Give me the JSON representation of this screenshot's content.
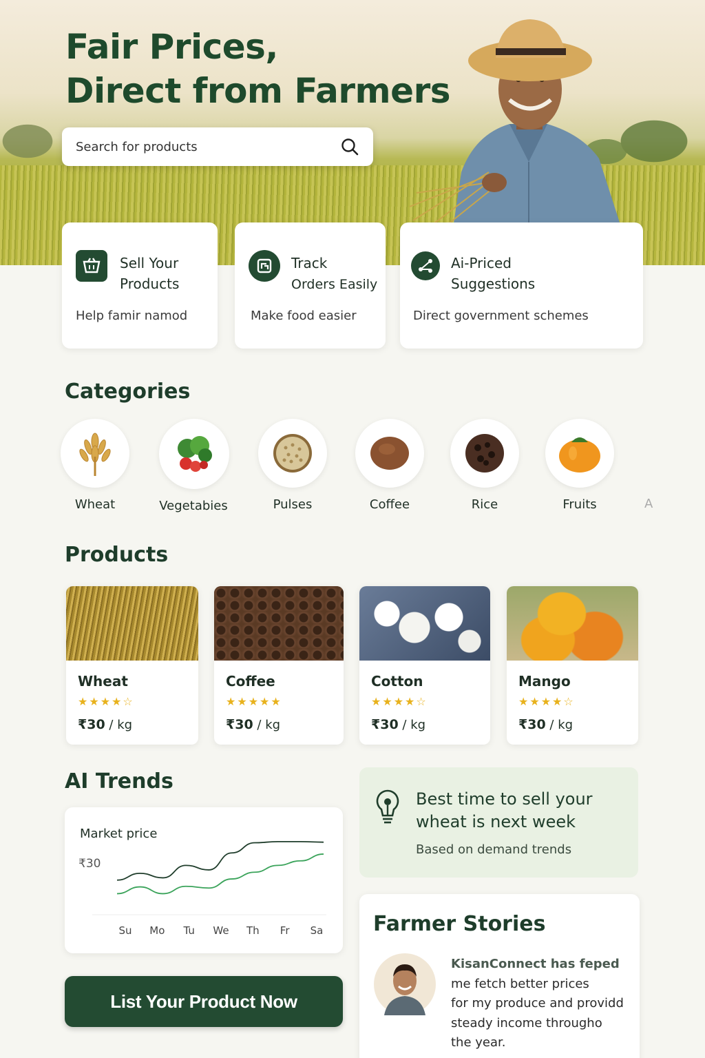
{
  "hero": {
    "title_line1": "Fair Prices,",
    "title_line2": "Direct from Farmers",
    "search_placeholder": "Search for products"
  },
  "features": [
    {
      "title_line1": "Sell Your",
      "title_line2": "Products",
      "desc": "Help famir namod",
      "icon": "basket-icon"
    },
    {
      "title_line1": "Track",
      "title_line2": "Orders Easily",
      "desc": "Make food easier",
      "icon": "tracking-icon"
    },
    {
      "title_line1": "Ai-Priced",
      "title_line2": "Suggestions",
      "desc": "Direct government schemes",
      "icon": "ai-network-icon"
    }
  ],
  "categories_title": "Categories",
  "categories": [
    "Wheat",
    "Vegetabies",
    "Pulses",
    "Coffee",
    "Rice",
    "Fruits"
  ],
  "categories_more": "A",
  "products_title": "Products",
  "products": [
    {
      "name": "Wheat",
      "stars": "★★★★☆",
      "rating": 4.5,
      "currency": "₹",
      "price": "30",
      "unit": "/ kg"
    },
    {
      "name": "Coffee",
      "stars": "★★★★★",
      "rating": 5,
      "currency": "₹",
      "price": "30",
      "unit": "/ kg"
    },
    {
      "name": "Cotton",
      "stars": "★★★★☆",
      "rating": 4.5,
      "currency": "₹",
      "price": "30",
      "unit": "/ kg"
    },
    {
      "name": "Mango",
      "stars": "★★★★☆",
      "rating": 4.5,
      "currency": "₹",
      "price": "30",
      "unit": "/ kg"
    }
  ],
  "trends": {
    "title": "AI Trends",
    "chart_label": "Market price",
    "price_label": "₹30"
  },
  "chart_data": {
    "type": "line",
    "categories": [
      "Su",
      "Mo",
      "Tu",
      "We",
      "Th",
      "Fr",
      "Sa"
    ],
    "series": [
      {
        "values": [
          30,
          31.2,
          30.4,
          32.6,
          31.8,
          34.8,
          36.6,
          36.8,
          36.8,
          36.7
        ],
        "color": "#1f3d2b"
      },
      {
        "values": [
          27.6,
          28.8,
          27.6,
          28.9,
          28.6,
          30.2,
          31.4,
          32.6,
          33.4,
          34.6
        ],
        "color": "#3aa35a"
      }
    ]
  },
  "tip": {
    "line1": "Best time to sell your",
    "line2": "wheat is next week",
    "sub": "Based on demand trends"
  },
  "stories": {
    "title": "Farmer Stories",
    "author": "KisanConnect has feped",
    "lines": [
      "me fetch better prices",
      "for my produce and providd",
      "steady income througho",
      "the year."
    ]
  },
  "cta_label": "List Your Product Now"
}
